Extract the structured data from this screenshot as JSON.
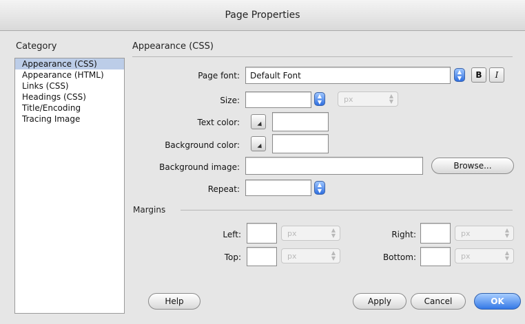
{
  "window": {
    "title": "Page Properties"
  },
  "category": {
    "heading": "Category",
    "items": [
      {
        "label": "Appearance (CSS)",
        "selected": true
      },
      {
        "label": "Appearance (HTML)"
      },
      {
        "label": "Links (CSS)"
      },
      {
        "label": "Headings (CSS)"
      },
      {
        "label": "Title/Encoding"
      },
      {
        "label": "Tracing Image"
      }
    ]
  },
  "section": {
    "title": "Appearance (CSS)"
  },
  "page_font": {
    "label": "Page font:",
    "value": "Default Font",
    "bold_glyph": "B",
    "italic_glyph": "I"
  },
  "size": {
    "label": "Size:",
    "value": "",
    "unit": "px"
  },
  "text_color": {
    "label": "Text color:",
    "value": ""
  },
  "background_color": {
    "label": "Background color:",
    "value": ""
  },
  "background_image": {
    "label": "Background image:",
    "value": "",
    "browse_label": "Browse..."
  },
  "repeat": {
    "label": "Repeat:",
    "value": ""
  },
  "margins": {
    "heading": "Margins",
    "left": {
      "label": "Left:",
      "value": "",
      "unit": "px"
    },
    "top": {
      "label": "Top:",
      "value": "",
      "unit": "px"
    },
    "right": {
      "label": "Right:",
      "value": "",
      "unit": "px"
    },
    "bottom": {
      "label": "Bottom:",
      "value": "",
      "unit": "px"
    }
  },
  "buttons": {
    "help": "Help",
    "apply": "Apply",
    "cancel": "Cancel",
    "ok": "OK"
  },
  "colors": {
    "selection": "#bccde8",
    "accent": "#3478e6"
  }
}
